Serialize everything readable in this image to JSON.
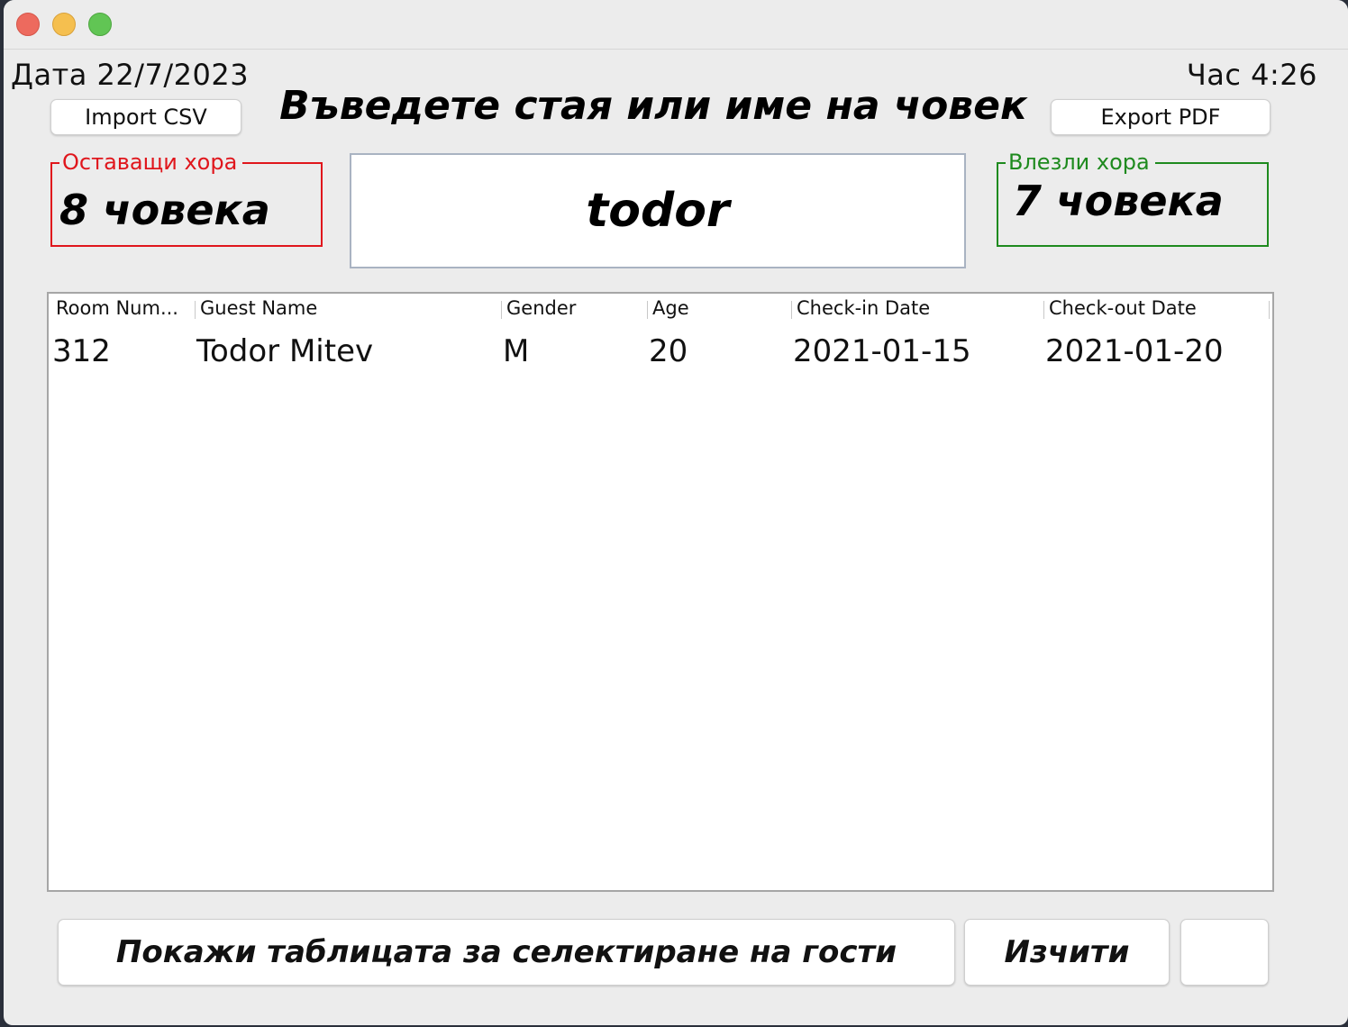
{
  "header": {
    "date_label": "Дата 22/7/2023",
    "time_label": "Час 4:26",
    "title": "Въведете стая или име на човек"
  },
  "toolbar": {
    "import_label": "Import CSV",
    "export_label": "Export PDF"
  },
  "counters": {
    "remaining": {
      "legend": "Оставащи хора",
      "value": "8 човека",
      "color": "#e0161c"
    },
    "entered": {
      "legend": "Влезли хора",
      "value": "7 човека",
      "color": "#1e8a1e"
    }
  },
  "search": {
    "value": "todor"
  },
  "table": {
    "columns": [
      "Room Num...",
      "Guest Name",
      "Gender",
      "Age",
      "Check-in Date",
      "Check-out Date"
    ],
    "rows": [
      [
        "312",
        "Todor Mitev",
        "M",
        "20",
        "2021-01-15",
        "2021-01-20"
      ]
    ]
  },
  "footer": {
    "show_table_label": "Покажи таблицата за селектиране на гости",
    "clear_label": "Изчити",
    "extra_label": ""
  }
}
